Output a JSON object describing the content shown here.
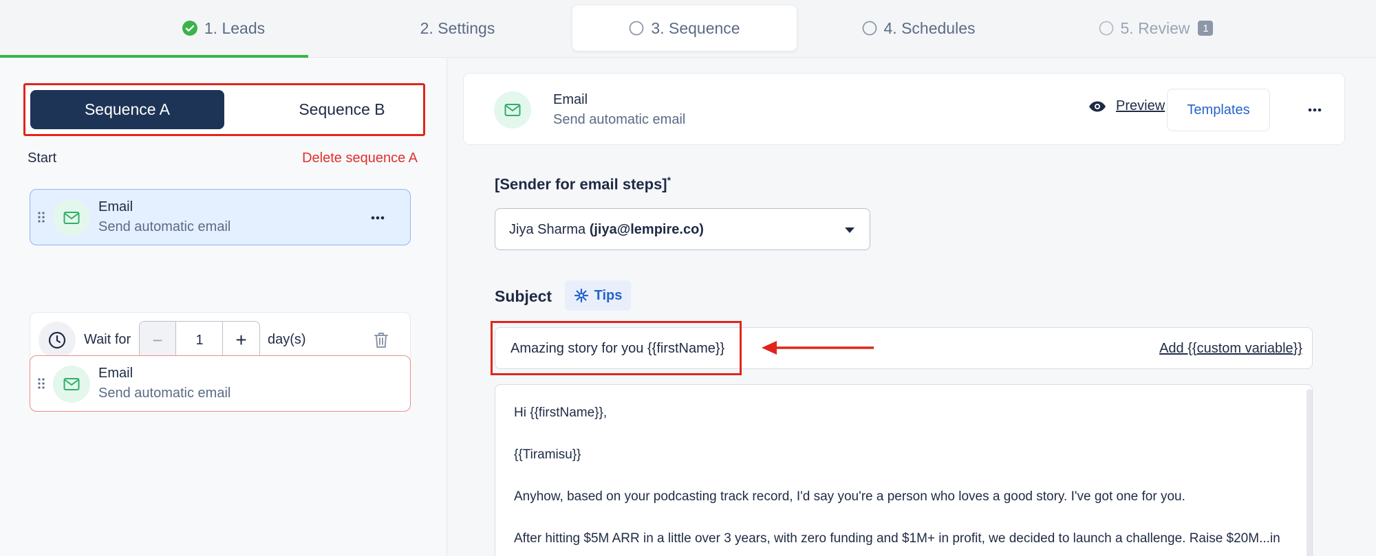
{
  "stepper": {
    "steps": [
      {
        "label": "1. Leads",
        "state": "done"
      },
      {
        "label": "2. Settings",
        "state": "idle"
      },
      {
        "label": "3. Sequence",
        "state": "active"
      },
      {
        "label": "4. Schedules",
        "state": "idle"
      },
      {
        "label": "5. Review",
        "state": "disabled",
        "badge": "1"
      }
    ],
    "progress": 0.224
  },
  "sequence_tabs": {
    "a_label": "Sequence A",
    "b_label": "Sequence B"
  },
  "left": {
    "start_label": "Start",
    "delete_label": "Delete sequence A",
    "email_card_1": {
      "title": "Email",
      "subtitle": "Send automatic email"
    },
    "wait": {
      "prefix": "Wait for",
      "value": "1",
      "suffix": "day(s)",
      "minus": "−",
      "plus": "+"
    },
    "email_card_2": {
      "title": "Email",
      "subtitle": "Send automatic email"
    }
  },
  "header": {
    "title": "Email",
    "subtitle": "Send automatic email",
    "preview_label": "Preview",
    "templates_label": "Templates"
  },
  "sender": {
    "label": "[Sender for email steps]",
    "required_mark": "*",
    "name": "Jiya Sharma",
    "email": "(jiya@lempire.co)"
  },
  "subject": {
    "label": "Subject",
    "tips_label": "Tips",
    "value": "Amazing story for you {{firstName}}",
    "add_variable": "Add {{custom variable}}"
  },
  "body": {
    "lines": [
      "Hi {{firstName}},",
      "{{Tiramisu}}",
      "Anyhow, based on your podcasting track record, I'd say you're a person who loves a good story. I've got one for you.",
      "After hitting $5M ARR in a little over 3 years, with zero funding and $1M+ in profit, we decided to launch a challenge. Raise $20M...in"
    ]
  },
  "colors": {
    "primary_dark": "#1d3456",
    "accent_blue": "#2563c9",
    "success_green": "#3ab449",
    "danger_red": "#e0312b",
    "annotation_red": "#e0251b"
  },
  "icons": {
    "done": "check-circle-icon",
    "pending": "circle-outline-icon",
    "mail": "mail-icon",
    "clock": "clock-icon",
    "trash": "trash-icon",
    "eye": "eye-icon",
    "tips": "sparkle-icon",
    "more": "more-horizontal-icon",
    "drag": "drag-handle-icon",
    "caret": "caret-down-icon"
  }
}
